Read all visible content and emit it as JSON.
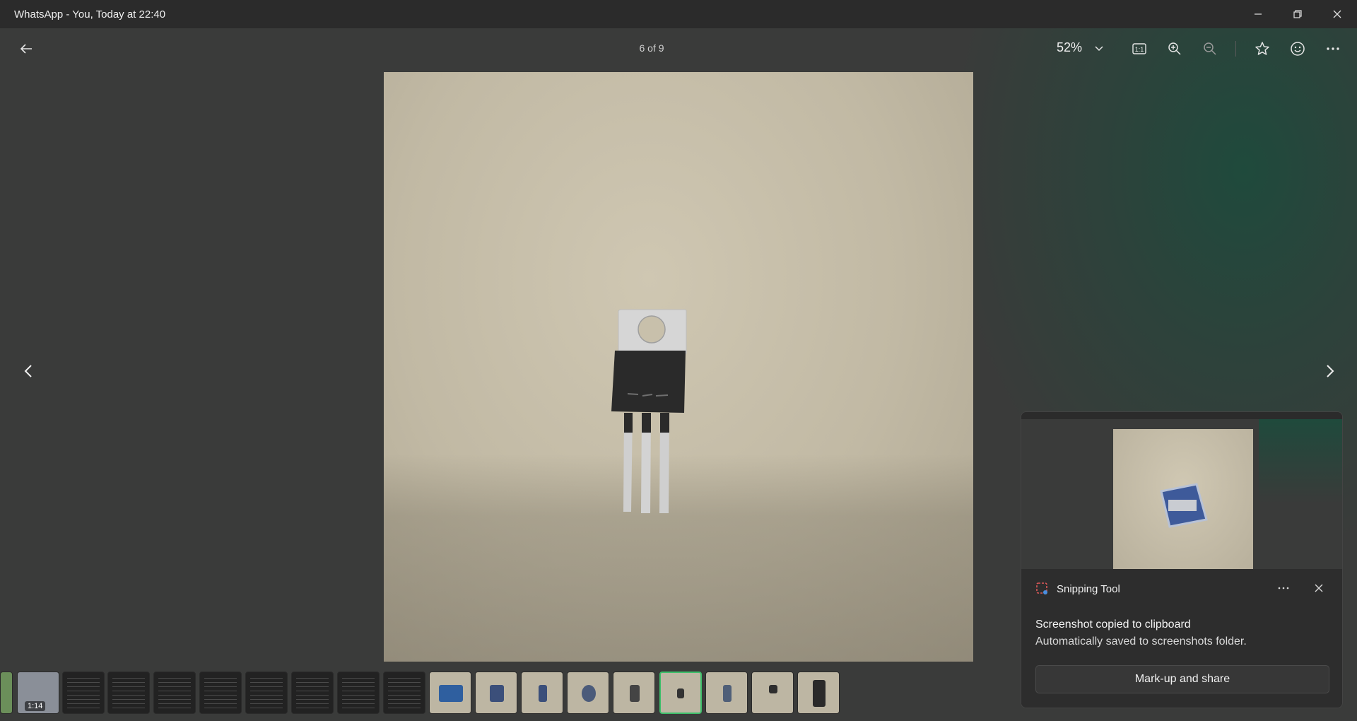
{
  "window": {
    "title": "WhatsApp - You, Today at 22:40"
  },
  "viewer": {
    "counter": "6 of 9",
    "zoom_level": "52%"
  },
  "filmstrip": {
    "video_duration": "1:14",
    "selected_index": 15
  },
  "toast": {
    "app_name": "Snipping Tool",
    "heading": "Screenshot copied to clipboard",
    "subtext": "Automatically saved to screenshots folder.",
    "action_label": "Mark-up and share"
  },
  "colors": {
    "selected_border": "#3dbf6a",
    "background": "#3a3b3a",
    "titlebar": "#2b2b2b"
  },
  "icons": [
    "back-arrow-icon",
    "chevron-down-icon",
    "actual-size-icon",
    "zoom-in-icon",
    "zoom-out-icon",
    "star-icon",
    "emoji-icon",
    "more-icon",
    "previous-icon",
    "next-icon",
    "minimize-icon",
    "maximize-icon",
    "close-icon",
    "snipping-tool-icon"
  ]
}
